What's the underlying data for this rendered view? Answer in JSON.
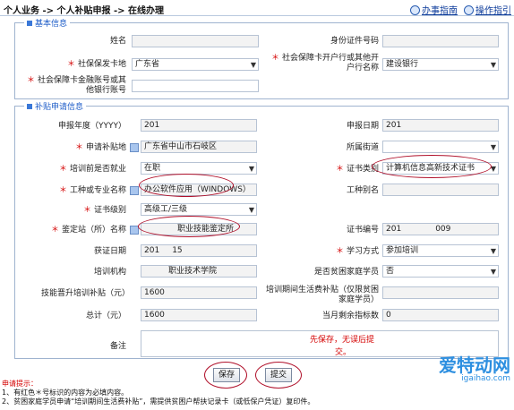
{
  "breadcrumb": "个人业务 -> 个人补贴申报 -> 在线办理",
  "top_links": {
    "guide": "办事指南",
    "help": "操作指引"
  },
  "basic": {
    "legend": "基本信息",
    "name_label": "姓名",
    "idno_label": "身份证件号码",
    "issue_place_label": "社保保发卡地",
    "issue_place_value": "广东省",
    "bank_label": "社会保障卡开户行或其他开户行名称",
    "bank_value": "建设银行",
    "account_label": "社会保障卡金融账号或其他银行账号"
  },
  "apply": {
    "legend": "补贴申请信息",
    "year_label": "申报年度（YYYY）",
    "year_value": "201",
    "date_label": "申报日期",
    "date_value": "201",
    "place_label": "申请补贴地",
    "place_value": "广东省中山市石岐区",
    "street_label": "所属街道",
    "employ_label": "培训前是否就业",
    "employ_value": "在职",
    "cert_type_label": "证书类别",
    "cert_type_value": "计算机信息高新技术证书",
    "job_label": "工种或专业名称",
    "job_value": "办公软件应用（WINDOWS）",
    "alias_label": "工种别名",
    "level_label": "证书级别",
    "level_value": "高级工/三级",
    "agency_label": "鉴定站（所）名称",
    "agency_value": "职业技能鉴定所",
    "cert_no_label": "证书编号",
    "cert_no_value": "201",
    "cert_no_tail": "009",
    "get_date_label": "获证日期",
    "get_date_value": "201",
    "get_date_tail": "15",
    "mode_label": "学习方式",
    "mode_value": "参加培训",
    "org_label": "培训机构",
    "org_value": "职业技术学院",
    "poor_label": "是否贫困家庭学员",
    "poor_value": "否",
    "skill_sub_label": "技能晋升培训补贴（元）",
    "skill_sub_value": "1600",
    "living_label": "培训期间生活费补贴（仅限贫困家庭学员）",
    "total_label": "总计（元）",
    "total_value": "1600",
    "index_label": "当月剩余指标数",
    "index_value": "0",
    "remark_label": "备注"
  },
  "buttons": {
    "save": "保存",
    "submit": "提交"
  },
  "note_save": "先保存，无误后提",
  "note_save2": "交。",
  "tips": {
    "title": "申请提示：",
    "line1": "1、有红色＊号标识的内容为必填内容。",
    "line2": "2、贫困家庭学员申请“培训期间生活费补贴”，需提供贫困户帮扶记录卡（或低保户凭证）复印件。"
  },
  "watermark": {
    "top": "爱特动网",
    "bottom": "igaihao.com"
  },
  "colors": {
    "required": "#d40000",
    "ring": "#b0102a",
    "accent": "#1d5cc8"
  }
}
